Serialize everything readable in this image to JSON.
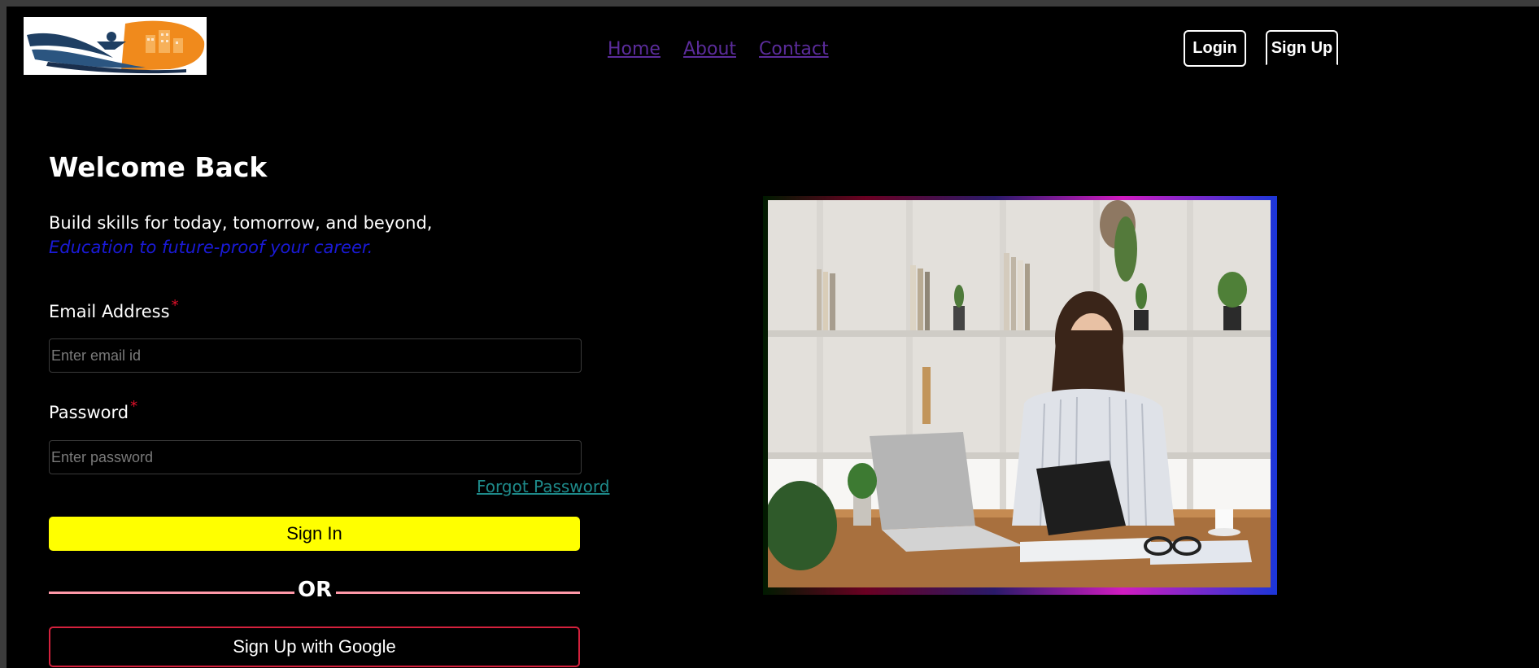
{
  "header": {
    "nav": [
      {
        "label": "Home"
      },
      {
        "label": "About"
      },
      {
        "label": "Contact"
      }
    ],
    "login_label": "Login",
    "signup_label": "Sign Up"
  },
  "hero": {
    "title": "Welcome Back",
    "subtitle": "Build skills for today, tomorrow, and beyond,",
    "tagline": "Education to future-proof your career."
  },
  "form": {
    "email_label": "Email Address",
    "email_required": "*",
    "email_placeholder": "Enter email id",
    "email_value": "",
    "password_label": "Password",
    "password_required": "*",
    "password_placeholder": "Enter password",
    "password_value": "",
    "forgot_label": "Forgot Password",
    "signin_label": "Sign In",
    "or_text": "OR",
    "google_label": "Sign Up with Google"
  },
  "colors": {
    "signin_bg": "#ffff00",
    "tagline": "#1a1ad6",
    "nav_link": "#5b2c9b",
    "forgot_link": "#1e8a8a",
    "google_border": "#d4213d",
    "required": "#e0102a",
    "or_divider": "#ff98a8"
  },
  "logo": {
    "icon": "education-logo"
  },
  "photo": {
    "icon": "woman-at-desk-photo"
  }
}
